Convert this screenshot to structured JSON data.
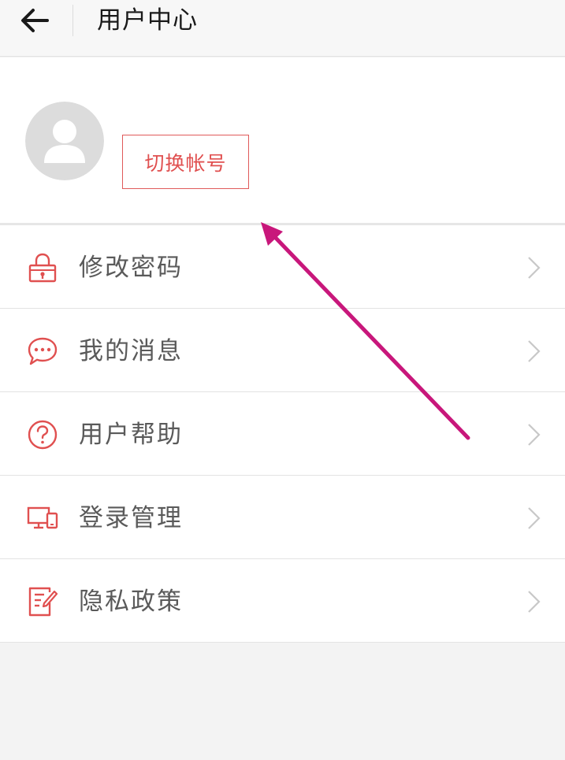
{
  "header": {
    "title": "用户中心",
    "back_icon": "arrow-left-icon"
  },
  "profile": {
    "avatar_icon": "default-user-avatar-icon",
    "switch_account_label": "切换帐号"
  },
  "menu": {
    "items": [
      {
        "label": "修改密码",
        "icon": "lock-icon"
      },
      {
        "label": "我的消息",
        "icon": "chat-bubble-icon"
      },
      {
        "label": "用户帮助",
        "icon": "question-circle-icon"
      },
      {
        "label": "登录管理",
        "icon": "devices-icon"
      },
      {
        "label": "隐私政策",
        "icon": "document-edit-icon"
      }
    ]
  },
  "colors": {
    "accent": "#e05050",
    "annotation_arrow": "#c8177b",
    "background": "#f3f3f3",
    "text_primary": "#1a1a1a",
    "text_menu": "#5a5a5a"
  }
}
